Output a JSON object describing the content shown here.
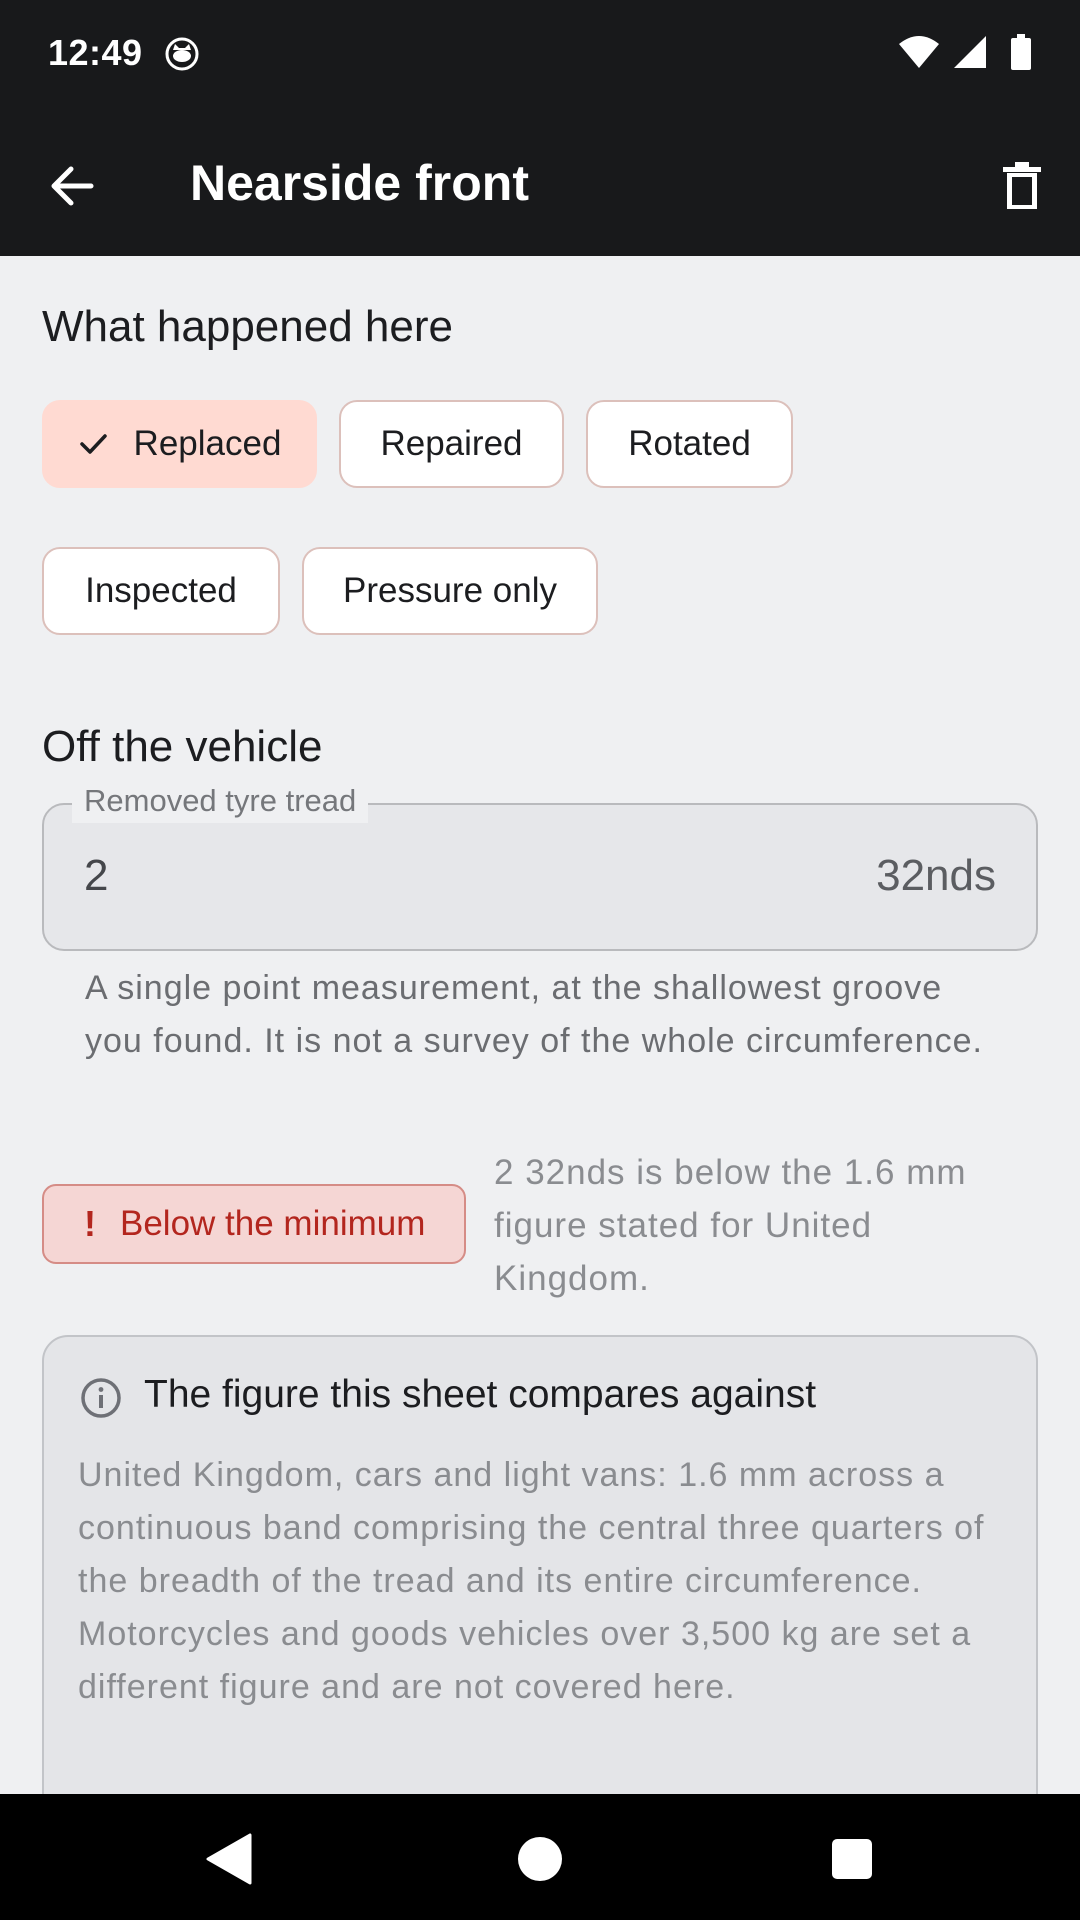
{
  "status_bar": {
    "time": "12:49"
  },
  "app_bar": {
    "title": "Nearside front",
    "back_icon": "arrow-back-icon",
    "delete_icon": "trash-icon"
  },
  "what_happened": {
    "heading": "What happened here",
    "chips": [
      {
        "label": "Replaced",
        "selected": true
      },
      {
        "label": "Repaired",
        "selected": false
      },
      {
        "label": "Rotated",
        "selected": false
      },
      {
        "label": "Inspected",
        "selected": false
      },
      {
        "label": "Pressure only",
        "selected": false
      }
    ]
  },
  "off_vehicle": {
    "heading": "Off the vehicle",
    "tread_field": {
      "label": "Removed tyre tread",
      "value": "2",
      "suffix": "32nds"
    },
    "helper": "A single point measurement, at the shallowest groove you found. It is not a survey of the whole circumference.",
    "warning_badge": "Below the minimum",
    "warning_text": "2 32nds is below the 1.6 mm figure stated for United Kingdom."
  },
  "info_card": {
    "title": "The figure this sheet compares against",
    "body": "United Kingdom, cars and light vans: 1.6 mm across a continuous band comprising the central three quarters of the breadth of the tread and its entire circumference. Motorcycles and goods vehicles over 3,500 kg are set a different figure and are not covered here."
  },
  "colors": {
    "app_bar": "#18191b",
    "background": "#eff0f2",
    "selected_chip": "#ffdad2",
    "warning": "#b3261e"
  }
}
